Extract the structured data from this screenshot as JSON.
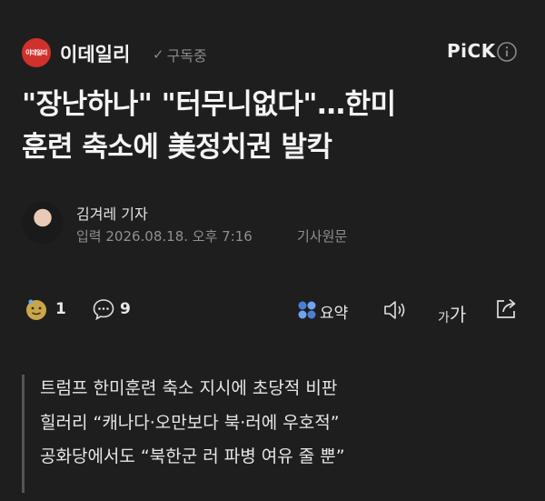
{
  "header": {
    "press_logo_text": "이데일리",
    "press_name": "이데일리",
    "subscribe_label": "구독중",
    "pick_label": "PiCK"
  },
  "article": {
    "headline_line1": "\"장난하나\" \"터무니없다\"…한미",
    "headline_line2": "훈련 축소에 美정치권 발칵",
    "reporter": "김겨레 기자",
    "published": "입력 2026.08.18. 오후 7:16",
    "original_link": "기사원문"
  },
  "actions": {
    "reaction_count": "1",
    "comment_count": "9",
    "summary_label": "요약",
    "font_small": "가",
    "font_big": "가"
  },
  "summary": {
    "lines": [
      "트럼프 한미훈련 축소 지시에 초당적 비판",
      "힐러리 “캐나다·오만보다 북·러에 우호적”",
      "공화당에서도 “북한군 러 파병 여유 줄 뿐”"
    ]
  },
  "colors": {
    "background": "#1e1e1e",
    "logo_red": "#d0312d",
    "muted_text": "#8f8f8f"
  }
}
